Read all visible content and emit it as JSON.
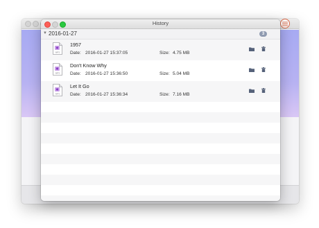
{
  "window": {
    "title": "History"
  },
  "group": {
    "date": "2016-01-27",
    "count": "3"
  },
  "labels": {
    "date": "Date:",
    "size": "Size:"
  },
  "file_type_label": "MP3",
  "records": [
    {
      "title": "1957",
      "date": "2016-01-27 15:37:05",
      "size": "4.75 MB"
    },
    {
      "title": "Don't Know Why",
      "date": "2016-01-27 15:36:50",
      "size": "5.04 MB"
    },
    {
      "title": "Let It Go",
      "date": "2016-01-27 15:36:34",
      "size": "7.16 MB"
    }
  ],
  "icons": {
    "menu": "menu-icon",
    "file": "mp3-file-icon",
    "folder": "folder-icon",
    "trash": "trash-icon",
    "disclosure": "disclosure-triangle-icon"
  },
  "colors": {
    "accent_menu_ring": "#d96a4a",
    "badge": "#8f9ab0",
    "close": "#fd5f57",
    "zoom": "#2ac840",
    "bg_band": "#b0aef2"
  }
}
